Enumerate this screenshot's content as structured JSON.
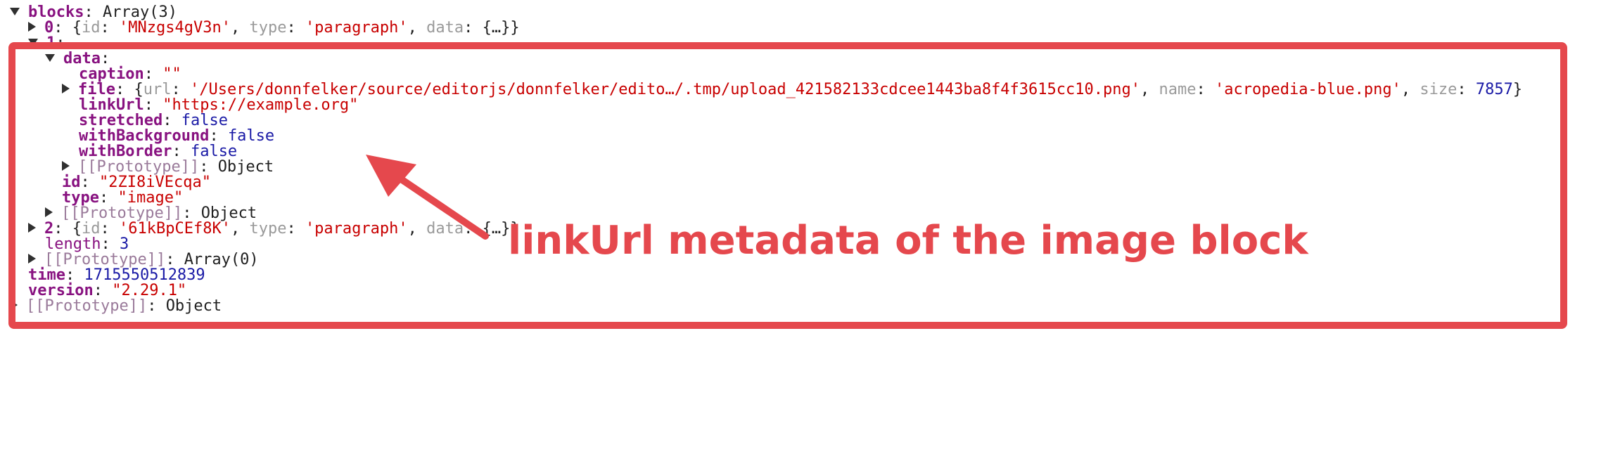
{
  "tree": {
    "blocks_key": "blocks",
    "blocks_value": "Array(3)",
    "block0": {
      "index": "0",
      "summary_id_key": "id",
      "summary_id": "'MNzgs4gV3n'",
      "summary_type_key": "type",
      "summary_type": "'paragraph'",
      "summary_data_key": "data",
      "summary_data": "{…}"
    },
    "block1": {
      "index": "1",
      "data_key": "data",
      "caption_key": "caption",
      "caption_value": "\"\"",
      "file_key": "file",
      "file_url_key": "url",
      "file_url": "'/Users/donnfelker/source/editorjs/donnfelker/edito…/.tmp/upload_421582133cdcee1443ba8f4f3615cc10.png'",
      "file_name_key": "name",
      "file_name": "'acropedia-blue.png'",
      "file_size_key": "size",
      "file_size": "7857",
      "linkUrl_key": "linkUrl",
      "linkUrl_value": "\"https://example.org\"",
      "stretched_key": "stretched",
      "stretched_value": "false",
      "withBackground_key": "withBackground",
      "withBackground_value": "false",
      "withBorder_key": "withBorder",
      "withBorder_value": "false",
      "data_proto_key": "[[Prototype]]",
      "data_proto_value": "Object",
      "id_key": "id",
      "id_value": "\"2ZI8iVEcqa\"",
      "type_key": "type",
      "type_value": "\"image\"",
      "proto_key": "[[Prototype]]",
      "proto_value": "Object"
    },
    "block2": {
      "index": "2",
      "summary_id_key": "id",
      "summary_id": "'61kBpCEf8K'",
      "summary_type_key": "type",
      "summary_type": "'paragraph'",
      "summary_data_key": "data",
      "summary_data": "{…}"
    },
    "length_key": "length",
    "length_value": "3",
    "array_proto_key": "[[Prototype]]",
    "array_proto_value": "Array(0)",
    "time_key": "time",
    "time_value": "1715550512839",
    "version_key": "version",
    "version_value": "\"2.29.1\"",
    "root_proto_key": "[[Prototype]]",
    "root_proto_value": "Object"
  },
  "annotation": {
    "text": "linkUrl metadata of the image block",
    "color": "#e5484d"
  },
  "colors": {
    "key": "#881280",
    "string": "#c80000",
    "number": "#1a1aa6",
    "highlight": "#e5484d"
  }
}
